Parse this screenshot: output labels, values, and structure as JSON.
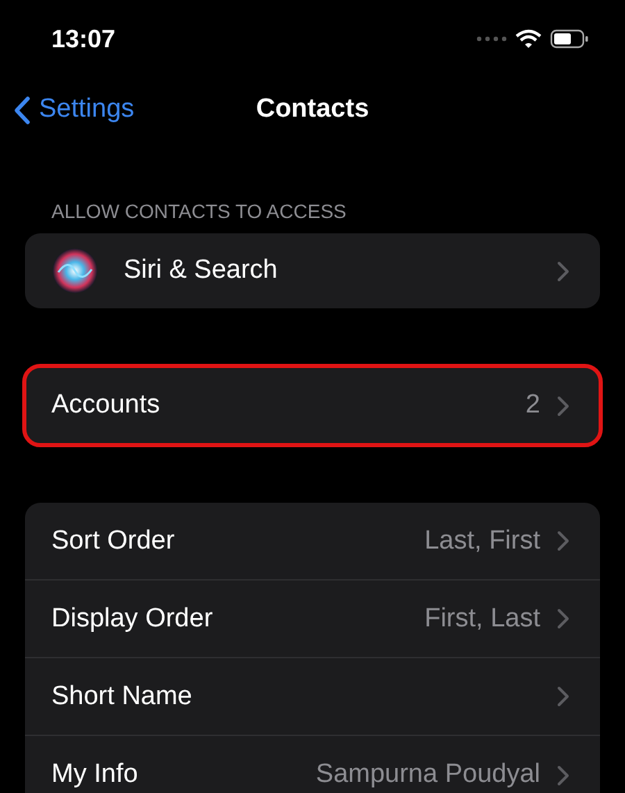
{
  "status_bar": {
    "time": "13:07"
  },
  "nav": {
    "back": "Settings",
    "title": "Contacts"
  },
  "sections": [
    {
      "header": "ALLOW CONTACTS TO ACCESS",
      "highlighted": false,
      "rows": [
        {
          "kind": "app",
          "label": "Siri & Search"
        }
      ]
    },
    {
      "highlighted": true,
      "rows": [
        {
          "kind": "plain",
          "label": "Accounts",
          "value": "2"
        }
      ]
    },
    {
      "highlighted": false,
      "rows": [
        {
          "kind": "plain",
          "label": "Sort Order",
          "value": "Last, First"
        },
        {
          "kind": "plain",
          "label": "Display Order",
          "value": "First, Last"
        },
        {
          "kind": "plain",
          "label": "Short Name"
        },
        {
          "kind": "plain",
          "label": "My Info",
          "value": "Sampurna Poudyal"
        }
      ]
    }
  ]
}
